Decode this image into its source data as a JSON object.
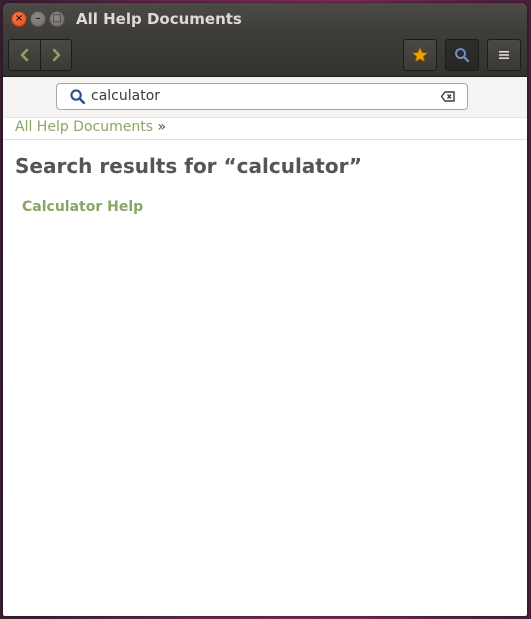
{
  "window": {
    "title": "All Help Documents",
    "controls": {
      "close": "×",
      "minimize": "–",
      "maximize": "□"
    }
  },
  "toolbar": {
    "back_icon": "chevron-left-icon",
    "forward_icon": "chevron-right-icon",
    "bookmark_icon": "star-icon",
    "search_icon": "search-icon",
    "menu_icon": "hamburger-menu-icon"
  },
  "search": {
    "value": "calculator",
    "placeholder": ""
  },
  "breadcrumb": {
    "link": "All Help Documents",
    "separator": "»"
  },
  "main": {
    "heading": "Search results for “calculator”",
    "results": [
      {
        "label": "Calculator Help"
      }
    ]
  },
  "colors": {
    "titlebar": "#3d3c38",
    "link": "#8aa566",
    "heading": "#555555",
    "accent_star": "#f0a000",
    "close_button": "#df4a16"
  }
}
